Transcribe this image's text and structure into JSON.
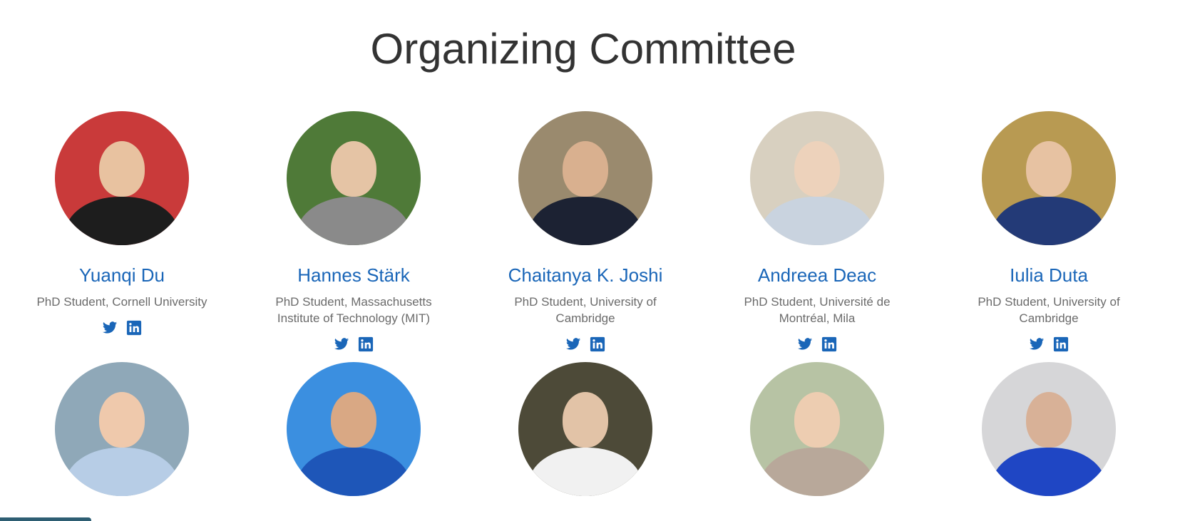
{
  "page": {
    "title": "Organizing Committee"
  },
  "colors": {
    "name_link": "#1a66b8",
    "role_text": "#6b6b6b",
    "social_icon": "#1a66b8",
    "title_text": "#333333"
  },
  "icons": {
    "twitter": "twitter-icon",
    "linkedin": "linkedin-icon"
  },
  "members": [
    {
      "name": "Yuanqi Du",
      "role": "PhD Student, Cornell University"
    },
    {
      "name": "Hannes Stärk",
      "role": "PhD Student, Massachusetts Institute of Technology (MIT)"
    },
    {
      "name": "Chaitanya K. Joshi",
      "role": "PhD Student, University of Cambridge"
    },
    {
      "name": "Andreea Deac",
      "role": "PhD Student, Université de Montréal, Mila"
    },
    {
      "name": "Iulia Duta",
      "role": "PhD Student, University of Cambridge"
    }
  ]
}
